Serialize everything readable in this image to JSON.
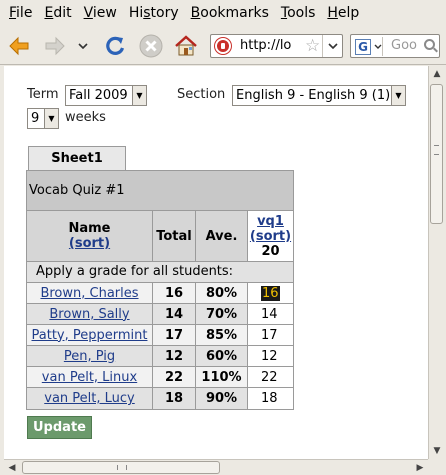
{
  "menubar": {
    "items": [
      {
        "u": "F",
        "rest": "ile"
      },
      {
        "u": "E",
        "rest": "dit"
      },
      {
        "u": "V",
        "rest": "iew"
      },
      {
        "u": "",
        "pre": "Hi",
        "mid": "s",
        "rest": "tory"
      },
      {
        "u": "B",
        "rest": "ookmarks"
      },
      {
        "u": "T",
        "rest": "ools"
      },
      {
        "u": "H",
        "rest": "elp"
      }
    ]
  },
  "toolbar": {
    "url": "http://lo",
    "search_placeholder": "Goo",
    "search_engine_letter": "G"
  },
  "form": {
    "term_label": "Term",
    "term_value": "Fall 2009",
    "section_label": "Section",
    "section_value": "English 9 - English 9 (1)",
    "weeks_value": "9",
    "weeks_label": "weeks"
  },
  "sheet": {
    "tab_label": "Sheet1",
    "quiz_title": "Vocab Quiz #1",
    "headers": {
      "name": "Name",
      "name_sort": "(sort)",
      "total": "Total",
      "ave": "Ave.",
      "vq": "vq1",
      "vq_sort": "(sort)",
      "vq_points": "20"
    },
    "apply_label": "Apply a grade for all students:",
    "rows": [
      {
        "name": "Brown, Charles",
        "total": "16",
        "ave": "80%",
        "grade": "16"
      },
      {
        "name": "Brown, Sally",
        "total": "14",
        "ave": "70%",
        "grade": "14"
      },
      {
        "name": "Patty, Peppermint",
        "total": "17",
        "ave": "85%",
        "grade": "17"
      },
      {
        "name": "Pen, Pig",
        "total": "12",
        "ave": "60%",
        "grade": "12"
      },
      {
        "name": "van Pelt, Linux",
        "total": "22",
        "ave": "110%",
        "grade": "22"
      },
      {
        "name": "van Pelt, Lucy",
        "total": "18",
        "ave": "90%",
        "grade": "18"
      }
    ],
    "update_label": "Update"
  },
  "colors": {
    "update_button": "#6c9a6c",
    "link": "#1f3c8a",
    "focused_cell_bg": "#1a1a1a",
    "focused_cell_text": "#f0c000"
  }
}
